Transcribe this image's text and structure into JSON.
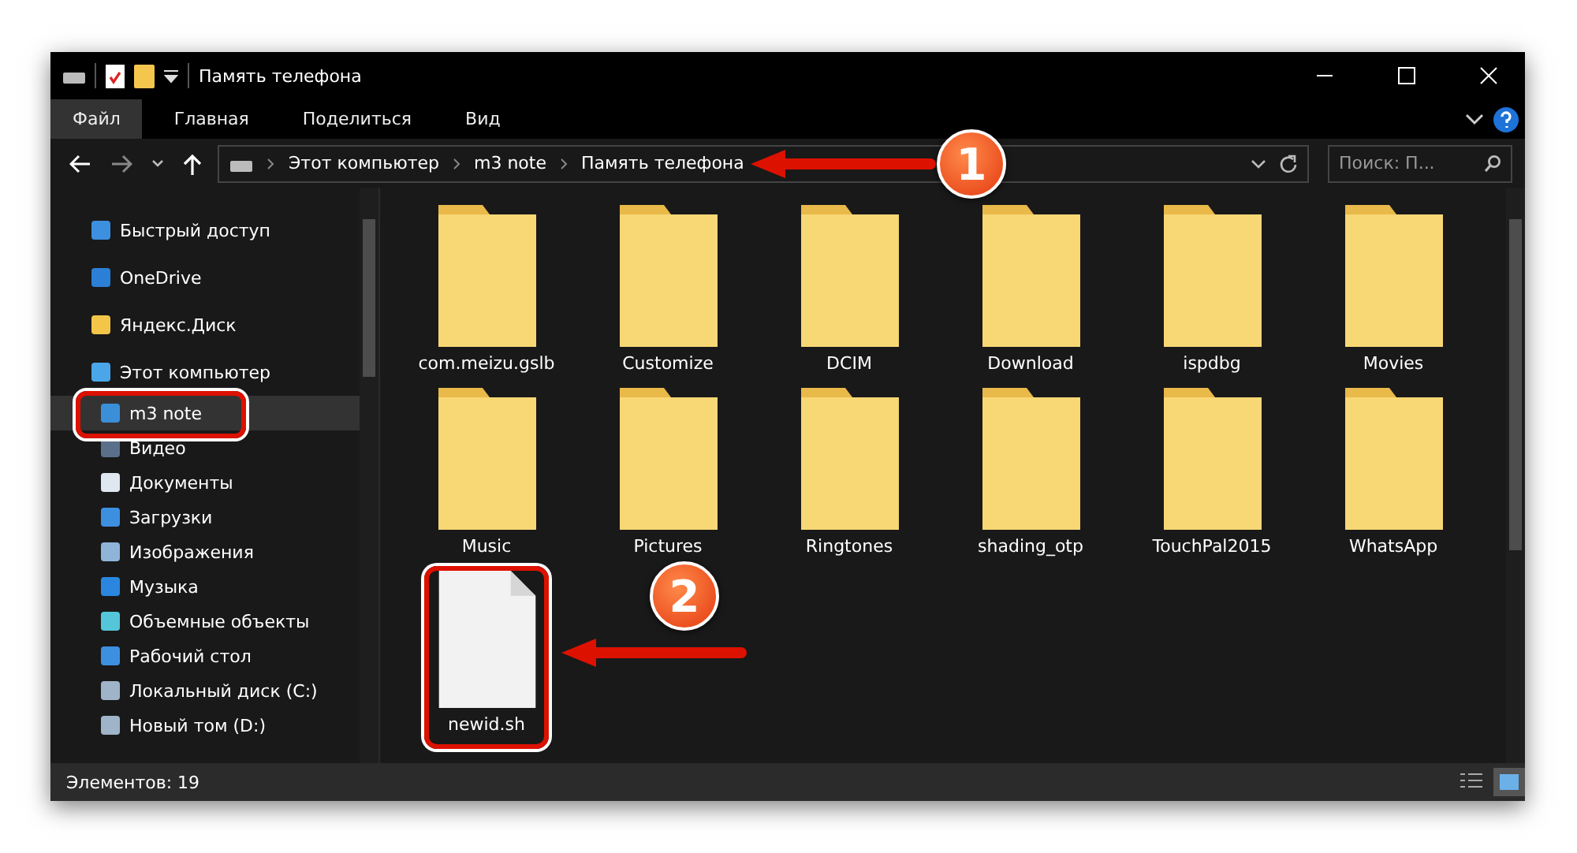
{
  "window": {
    "title": "Память телефона"
  },
  "ribbon_tabs": [
    {
      "label": "Файл",
      "selected": true
    },
    {
      "label": "Главная",
      "selected": false
    },
    {
      "label": "Поделиться",
      "selected": false
    },
    {
      "label": "Вид",
      "selected": false
    }
  ],
  "breadcrumbs": [
    "Этот компьютер",
    "m3 note",
    "Память телефона"
  ],
  "search": {
    "placeholder": "Поиск: П..."
  },
  "sidebar": {
    "items": [
      {
        "label": "Быстрый доступ",
        "selected": false
      },
      {
        "label": "OneDrive",
        "selected": false
      },
      {
        "label": "Яндекс.Диск",
        "selected": false
      },
      {
        "label": "Этот компьютер",
        "selected": false,
        "children": [
          {
            "label": "m3 note",
            "selected": true
          },
          {
            "label": "Видео",
            "selected": false
          },
          {
            "label": "Документы",
            "selected": false
          },
          {
            "label": "Загрузки",
            "selected": false
          },
          {
            "label": "Изображения",
            "selected": false
          },
          {
            "label": "Музыка",
            "selected": false
          },
          {
            "label": "Объемные объекты",
            "selected": false
          },
          {
            "label": "Рабочий стол",
            "selected": false
          },
          {
            "label": "Локальный диск (C:)",
            "selected": false
          },
          {
            "label": "Новый том (D:)",
            "selected": false
          }
        ]
      }
    ]
  },
  "files": [
    {
      "name": "com.meizu.gslb",
      "kind": "folder"
    },
    {
      "name": "Customize",
      "kind": "folder"
    },
    {
      "name": "DCIM",
      "kind": "folder"
    },
    {
      "name": "Download",
      "kind": "folder"
    },
    {
      "name": "ispdbg",
      "kind": "folder"
    },
    {
      "name": "Movies",
      "kind": "folder"
    },
    {
      "name": "Music",
      "kind": "folder"
    },
    {
      "name": "Pictures",
      "kind": "folder"
    },
    {
      "name": "Ringtones",
      "kind": "folder"
    },
    {
      "name": "shading_otp",
      "kind": "folder"
    },
    {
      "name": "TouchPal2015",
      "kind": "folder"
    },
    {
      "name": "WhatsApp",
      "kind": "folder"
    },
    {
      "name": "newid.sh",
      "kind": "file"
    }
  ],
  "status_bar": {
    "count": "Элементов: 19"
  },
  "callouts": [
    "1",
    "2"
  ]
}
